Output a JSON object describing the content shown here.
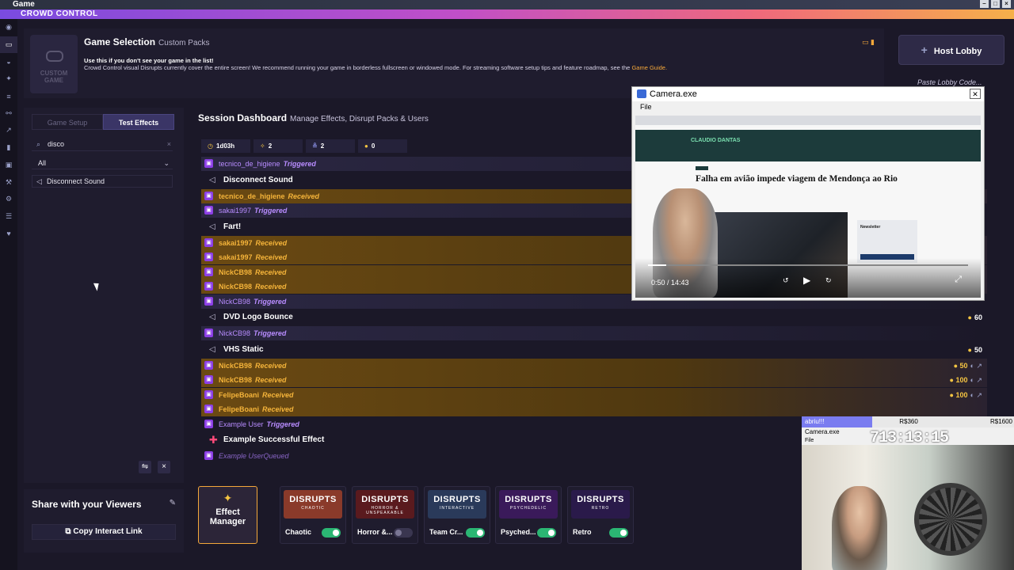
{
  "window": {
    "title": "Game",
    "app_title": "CROWD CONTROL"
  },
  "header": {
    "custom_game_label": "CUSTOM GAME",
    "title": "Game Selection",
    "subtitle": "Custom Packs",
    "info_line1": "Use this if you don't see your game in the list!",
    "info_line2": "Crowd Control visual Disrupts currently cover the entire screen! We recommend running your game in borderless fullscreen or windowed mode. For streaming software setup tips and feature roadmap, see the",
    "info_link": "Game Guide."
  },
  "lobby": {
    "host_label": "Host Lobby",
    "paste_placeholder": "Paste Lobby Code..."
  },
  "left_panel": {
    "tabs": [
      "Game Setup",
      "Test Effects"
    ],
    "search_value": "disco",
    "filter_value": "All",
    "result_item": "Disconnect Sound"
  },
  "share": {
    "title": "Share with your Viewers",
    "copy_label": "Copy Interact Link"
  },
  "dashboard": {
    "title": "Session Dashboard",
    "subtitle": "Manage Effects, Disrupt Packs & Users",
    "stats": [
      "1d03h",
      "2",
      "2",
      "0"
    ]
  },
  "feed": [
    {
      "kind": "row",
      "style": "trig",
      "user": "tecnico_de_higiene",
      "status": "Triggered"
    },
    {
      "kind": "effect",
      "name": "Disconnect Sound"
    },
    {
      "kind": "row",
      "style": "recv",
      "user": "tecnico_de_higiene",
      "status": "Received"
    },
    {
      "kind": "row",
      "style": "trig",
      "user": "sakai1997",
      "status": "Triggered"
    },
    {
      "kind": "effect",
      "name": "Fart!"
    },
    {
      "kind": "row",
      "style": "recv",
      "user": "sakai1997",
      "status": "Received"
    },
    {
      "kind": "row",
      "style": "recv",
      "user": "sakai1997",
      "status": "Received"
    },
    {
      "kind": "row",
      "style": "recv",
      "user": "NickCB98",
      "status": "Received"
    },
    {
      "kind": "row",
      "style": "recv",
      "user": "NickCB98",
      "status": "Received"
    },
    {
      "kind": "row",
      "style": "trig",
      "user": "NickCB98",
      "status": "Triggered"
    },
    {
      "kind": "effect",
      "name": "DVD Logo Bounce",
      "coins": "60"
    },
    {
      "kind": "row",
      "style": "trig",
      "user": "NickCB98",
      "status": "Triggered"
    },
    {
      "kind": "effect",
      "name": "VHS Static",
      "coins": "50"
    },
    {
      "kind": "row",
      "style": "recv",
      "user": "NickCB98",
      "status": "Received",
      "amount": "50"
    },
    {
      "kind": "row",
      "style": "recv",
      "user": "NickCB98",
      "status": "Received",
      "amount": "100"
    },
    {
      "kind": "row",
      "style": "recv",
      "user": "FelipeBoani",
      "status": "Received",
      "amount": "100"
    },
    {
      "kind": "row",
      "style": "recv",
      "user": "FelipeBoani",
      "status": "Received"
    },
    {
      "kind": "row",
      "style": "plain",
      "user": "Example User",
      "status": "Triggered"
    },
    {
      "kind": "effect",
      "name": "Example Successful Effect"
    },
    {
      "kind": "row",
      "style": "q",
      "user": "Example User",
      "status": "Queued"
    }
  ],
  "camera_window": {
    "title": "Camera.exe",
    "menu": "File",
    "site_logo": "CLAUDIO DANTAS",
    "headline": "Falha em avião impede viagem de Mendonça ao Rio",
    "newsletter": "Newsletter",
    "video_time": "0:50 / 14:43",
    "progress_fraction": 0.057
  },
  "webcam": {
    "bar_items": [
      "abriu!!!",
      "R$360",
      "R$1600"
    ],
    "title": "Camera.exe",
    "menu": "File",
    "clock": "713:13:15"
  },
  "packs": {
    "effect_manager_label": "Effect Manager",
    "items": [
      {
        "name": "Chaotic",
        "thumb_title": "DISRUPTS",
        "thumb_sub": "CHAOTIC",
        "enabled": true,
        "color": "#8a3a2a"
      },
      {
        "name": "Horror &...",
        "thumb_title": "DISRUPTS",
        "thumb_sub": "HORROR & UNSPEAKABLE",
        "enabled": false,
        "color": "#5a1a1e"
      },
      {
        "name": "Team Cr...",
        "thumb_title": "DISRUPTS",
        "thumb_sub": "INTERACTIVE",
        "enabled": true,
        "color": "#2a3a5a"
      },
      {
        "name": "Psyched...",
        "thumb_title": "DISRUPTS",
        "thumb_sub": "PSYCHEDELIC",
        "enabled": true,
        "color": "#3a1a5a"
      },
      {
        "name": "Retro",
        "thumb_title": "DISRUPTS",
        "thumb_sub": "RETRO",
        "enabled": true,
        "color": "#2a1a4a"
      }
    ]
  }
}
